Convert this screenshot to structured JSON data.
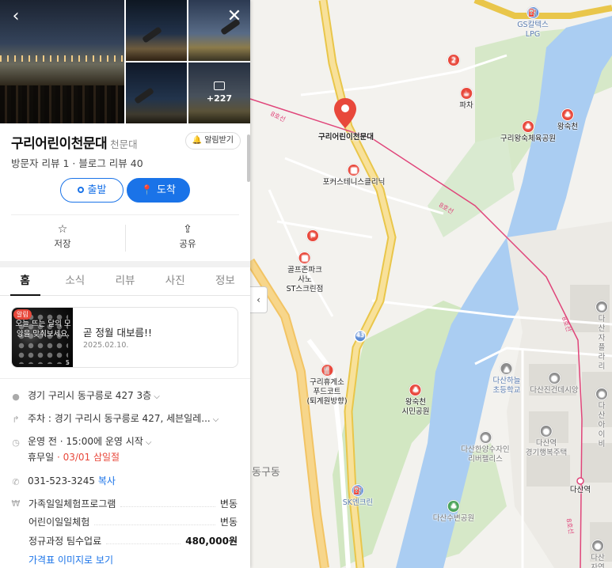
{
  "panel": {
    "back_icon": "chevron-left-icon",
    "close_icon": "close-icon",
    "photo_more": "+227",
    "place_name": "구리어린이천문대",
    "place_category": "천문대",
    "alarm_label": "알림받기",
    "reviews": "방문자 리뷰 1 · 블로그 리뷰 40",
    "depart_label": "출발",
    "arrive_label": "도착",
    "save_label": "저장",
    "share_label": "공유",
    "tabs": [
      {
        "label": "홈"
      },
      {
        "label": "소식"
      },
      {
        "label": "리뷰"
      },
      {
        "label": "사진"
      },
      {
        "label": "정보"
      }
    ],
    "news": {
      "badge": "알림",
      "thumb_caption": "오늘 뜨는 달의 모양을 맞춰보세요.",
      "thumb_count": "5",
      "title": "곧 정월 대보름!!",
      "date": "2025.02.10."
    },
    "address": "경기 구리시 동구릉로 427 3층",
    "parking": "주차 : 경기 구리시 동구릉로 427, 세븐일레...",
    "hours_status": "운영 전",
    "hours_detail": "· 15:00에 운영 시작",
    "holiday_label": "휴무일",
    "holiday_value": "· 03/01 삼일절",
    "phone": "031-523-3245",
    "copy_label": "복사",
    "prices": [
      {
        "name": "가족일일체험프로그램",
        "value": "변동"
      },
      {
        "name": "어린이일일체험",
        "value": "변동"
      },
      {
        "name": "정규과정 팀수업료",
        "value": "480,000원"
      }
    ],
    "price_link": "가격표 이미지로 보기"
  },
  "map": {
    "labels": {
      "gs": "GS칼텍스\nLPG",
      "pin_num": "2",
      "pacha": "파차",
      "observatory": "구리어린이천문대",
      "wangsukcheon": "왕숙천",
      "sports_park": "구리왕숙체육공원",
      "tennis": "포커스테니스클리닉",
      "golf": "골프존파크\n사노\nST스크린점",
      "rest_area": "구리휴게소\n푸드코트\n(퇴계원방향)",
      "citizen_park": "왕숙천\n시민공원",
      "school": "다산하늘\n초등학교",
      "dasan_jingeon": "다산진건데시앙",
      "dasan_happy": "다산역\n경기행복주택",
      "riverpalace": "다산한양수자인\n리버팰리스",
      "dasan_station": "다산역",
      "dasansu_park": "다산수변공원",
      "dasan_right1": "다산자\n플라리",
      "dasan_right2": "다산\n아이비",
      "dasan_right3": "다산\n자연앤푸",
      "sk": "SK엔크린",
      "dong": "동구동",
      "route_label": "8호선",
      "road_43": "43"
    },
    "collapse_icon": "chevron-left-icon"
  }
}
